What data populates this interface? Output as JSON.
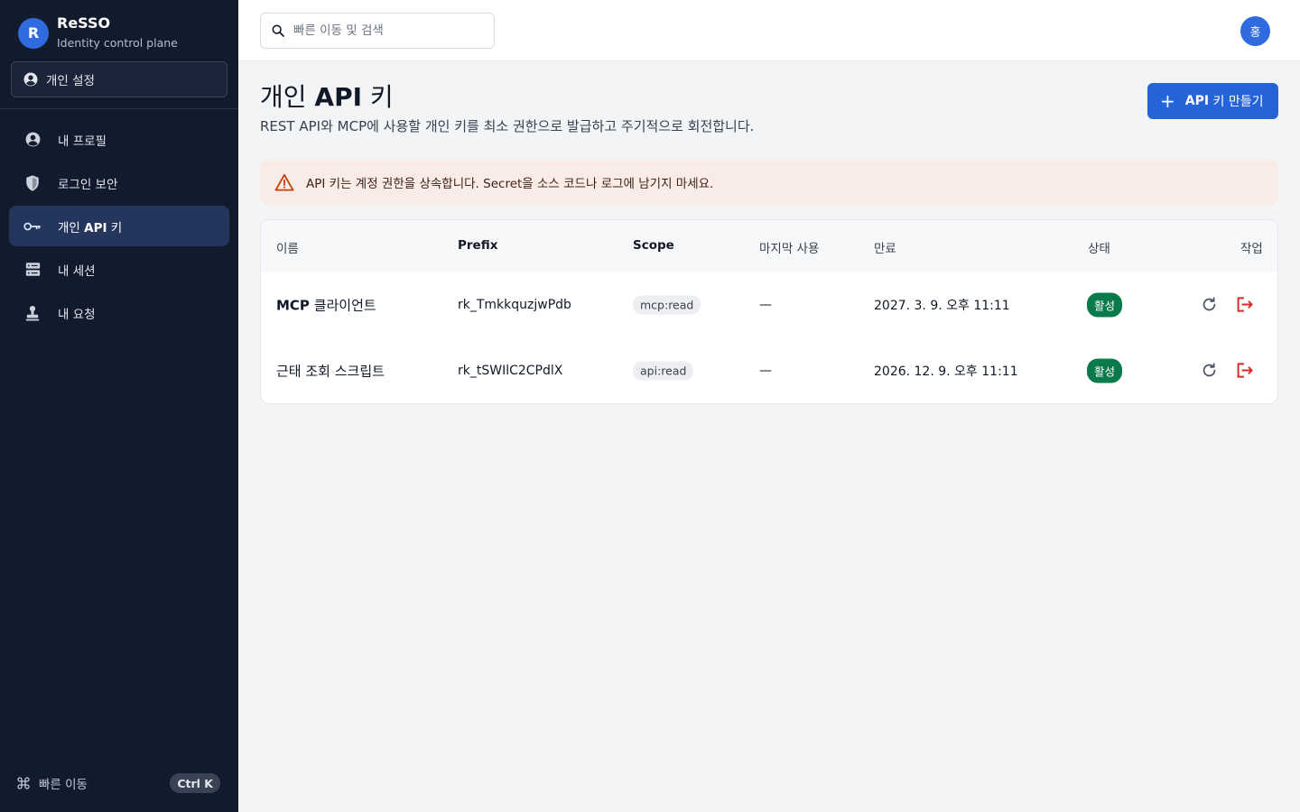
{
  "brand": {
    "logo_letter": "R",
    "name": "ReSSO",
    "subtitle": "Identity control plane"
  },
  "context_select": {
    "label": "개인 설정",
    "icon": "user-circle-icon"
  },
  "sidebar": {
    "items": [
      {
        "label": "내 프로필",
        "icon": "user-circle-icon",
        "active": false
      },
      {
        "label": "로그인 보안",
        "icon": "shield-icon",
        "active": false
      },
      {
        "label_prefix": "개인 ",
        "label_bold": "API",
        "label_suffix": " 키",
        "icon": "key-icon",
        "active": true
      },
      {
        "label": "내 세션",
        "icon": "server-icon",
        "active": false
      },
      {
        "label": "내 요청",
        "icon": "stamp-icon",
        "active": false
      }
    ],
    "quick_nav": {
      "label": "빠른 이동",
      "shortcut": "Ctrl K",
      "icon": "command-icon"
    }
  },
  "topbar": {
    "search_placeholder": "빠른 이동 및 검색",
    "avatar_initial": "홍"
  },
  "page": {
    "title_prefix": "개인 ",
    "title_bold": "API",
    "title_suffix": " 키",
    "description": "REST API와 MCP에 사용할 개인 키를 최소 권한으로 발급하고 주기적으로 회전합니다.",
    "create_button": {
      "plus": "+",
      "bold": "API",
      "rest": " 키 만들기"
    }
  },
  "alert": {
    "icon": "warning-triangle-icon",
    "text": "API 키는 계정 권한을 상속합니다. Secret을 소스 코드나 로그에 남기지 마세요."
  },
  "table": {
    "columns": [
      "이름",
      "Prefix",
      "Scope",
      "마지막 사용",
      "만료",
      "상태",
      "작업"
    ],
    "rows": [
      {
        "name_bold": "MCP",
        "name_rest": " 클라이언트",
        "prefix": "rk_TmkkquzjwPdb",
        "scope": "mcp:read",
        "last_used": "—",
        "expires": "2027. 3. 9. 오후 11:11",
        "status": "활성"
      },
      {
        "name_bold": "",
        "name_rest": "근태 조회 스크립트",
        "prefix": "rk_tSWIlC2CPdlX",
        "scope": "api:read",
        "last_used": "—",
        "expires": "2026. 12. 9. 오후 11:11",
        "status": "활성"
      }
    ],
    "actions": [
      "rotate-icon",
      "revoke-icon"
    ]
  },
  "colors": {
    "sidebar_bg": "#121a2d",
    "accent": "#2563d8",
    "active_nav": "#24365d",
    "alert_bg": "#f9ece7",
    "warning": "#c2410c",
    "status_active": "#0b7a4b",
    "revoke": "#dc2626"
  }
}
